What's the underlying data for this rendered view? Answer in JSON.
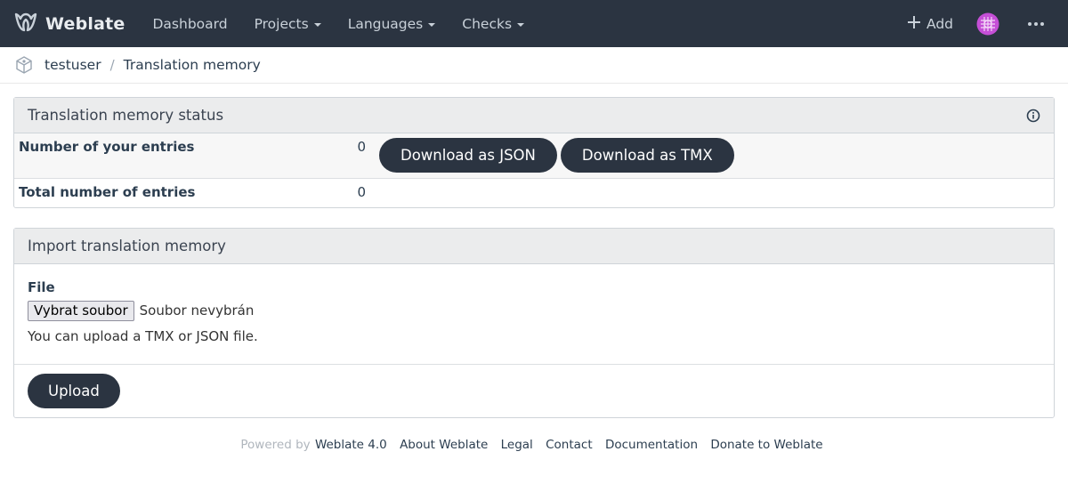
{
  "navbar": {
    "brand": "Weblate",
    "items": [
      {
        "label": "Dashboard",
        "dropdown": false
      },
      {
        "label": "Projects",
        "dropdown": true
      },
      {
        "label": "Languages",
        "dropdown": true
      },
      {
        "label": "Checks",
        "dropdown": true
      }
    ],
    "add_label": "Add",
    "icons": {
      "logo": "weblate-logo-icon",
      "add": "plus-icon",
      "avatar": "user-avatar",
      "more": "ellipsis-icon"
    },
    "colors": {
      "background": "#2b3441",
      "avatar": "#c54fd6"
    }
  },
  "breadcrumb": {
    "user": "testuser",
    "separator": "/",
    "page": "Translation memory"
  },
  "status_panel": {
    "title": "Translation memory status",
    "rows": [
      {
        "label": "Number of your entries",
        "value": "0"
      },
      {
        "label": "Total number of entries",
        "value": "0"
      }
    ],
    "download_json": "Download as JSON",
    "download_tmx": "Download as TMX"
  },
  "import_panel": {
    "title": "Import translation memory",
    "file_label": "File",
    "file_button": "Vybrat soubor",
    "file_status": "Soubor nevybrán",
    "help_text": "You can upload a TMX or JSON file.",
    "upload_label": "Upload"
  },
  "footer": {
    "powered_by": "Powered by",
    "links": [
      "Weblate 4.0",
      "About Weblate",
      "Legal",
      "Contact",
      "Documentation",
      "Donate to Weblate"
    ]
  }
}
